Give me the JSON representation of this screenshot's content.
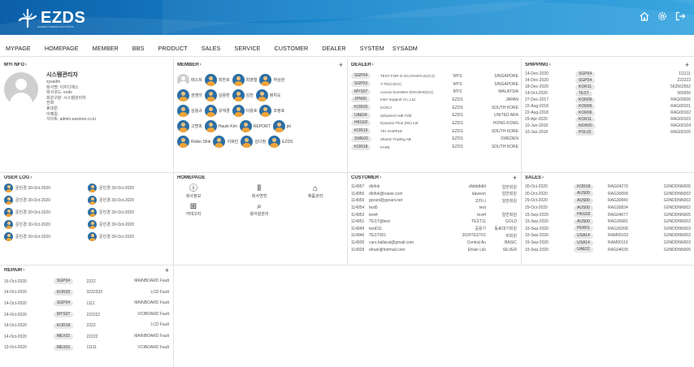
{
  "header": {
    "brand": "EZDS",
    "brand_sub": "ELEMENT DESIGN SOLUTIONS",
    "icons": [
      "home-icon",
      "gear-icon",
      "logout-icon"
    ]
  },
  "nav": [
    "MYPAGE",
    "HOMEPAGE",
    "MEMBER",
    "BBS",
    "PRODUCT",
    "SALES",
    "SERVICE",
    "CUSTOMER",
    "DEALER",
    "SYSTEM",
    "SYSADM"
  ],
  "myinfo": {
    "title": "MYI NFO",
    "name": "시스템관리자",
    "lines": [
      "sysadm",
      "회사명: 이지디에스",
      "회사코드: ezds",
      "회원구분: 시스템관리자",
      "전화:",
      "휴대폰:",
      "이메일:",
      "사이트: admin.easione.co.kr"
    ]
  },
  "member": {
    "title": "MEMBER",
    "rows": [
      [
        "테스트",
        "최한호",
        "최영철",
        "하상원"
      ],
      [
        "권영미",
        "김용환",
        "김찬",
        "배위도"
      ],
      [
        "심용규",
        "유재경",
        "이용호",
        "조정호"
      ],
      [
        "고명호",
        "Haule Kim",
        "REPORT",
        "pit"
      ],
      [
        "Robin Shin",
        "이화민",
        "김다정",
        "EZDS"
      ]
    ]
  },
  "dealer": {
    "title": "DEALER",
    "rows": [
      {
        "code": "SGP04",
        "name": "TEST FOR G-SCAN-MYL01(G1)",
        "group": "MYS",
        "country": "SINGAPORE"
      },
      {
        "code": "SGP03",
        "name": "Y-TECH(G1)",
        "group": "MYS",
        "country": "SINGAPORE"
      },
      {
        "code": "MYS07",
        "name": "Aurora SureWes SDN BHD(G1)",
        "group": "MYS",
        "country": "MALAYSIA"
      },
      {
        "code": "JPN00",
        "name": "Inter Support Co.,Ltd.",
        "group": "EZDS",
        "country": "JAPAN"
      },
      {
        "code": "KOR20",
        "name": "KOICA",
        "group": "EZDS",
        "country": "SOUTH KORE"
      },
      {
        "code": "UAE04",
        "name": "Zebartech ME FZE",
        "group": "EZDS",
        "country": "UNITED ARA"
      },
      {
        "code": "HKG02",
        "name": "Dynamic Plus (HK) Ltd",
        "group": "EZDS",
        "country": "HONG KONG"
      },
      {
        "code": "KOR19",
        "name": "TIH SAMPLE",
        "group": "EZDS",
        "country": "SOUTH KORE"
      },
      {
        "code": "SWE00",
        "name": "Skantz Trading AB",
        "group": "EZDS",
        "country": "SWEDEN"
      },
      {
        "code": "KOR18",
        "name": "FARK",
        "group": "EZDS",
        "country": "SOUTH KORE"
      }
    ]
  },
  "shipping": {
    "title": "SHIPPING",
    "rows": [
      {
        "date": "14-Dec-2020",
        "code": "SGP04",
        "no": "111111"
      },
      {
        "date": "14-Dec-2020",
        "code": "SGP04",
        "no": "222222"
      },
      {
        "date": "18-Dec-2020",
        "code": "KOR11",
        "no": "562562562"
      },
      {
        "date": "14-Oct-2020",
        "code": "TEST",
        "no": "565656"
      },
      {
        "date": "27-Dec-2017",
        "code": "KOR06",
        "no": "RAG00006"
      },
      {
        "date": "22-Aug-2018",
        "code": "KOR06",
        "no": "RAG00101"
      },
      {
        "date": "22-Aug-2018",
        "code": "KOR06",
        "no": "RAG00102"
      },
      {
        "date": "29-Apr-2020",
        "code": "KOR11",
        "no": "RAG00103"
      },
      {
        "date": "10-Jun-2018",
        "code": "NOR00",
        "no": "RAG00104"
      },
      {
        "date": "10-Jun-2018",
        "code": "POL02",
        "no": "RAG00105"
      }
    ]
  },
  "userlog": {
    "title": "USER LOG",
    "left": [
      "문민경 30-Oct-2020",
      "문민경 30-Oct-2020",
      "문민경 30-Oct-2020",
      "문민경 30-Oct-2020",
      "문민경 30-Oct-2020"
    ],
    "right": [
      "문민경 30-Oct-2020",
      "문민경 30-Oct-2020",
      "문민경 30-Oct-2020",
      "문민경 30-Oct-2020",
      "문민경 30-Oct-2020"
    ]
  },
  "homepage": {
    "title": "HOMEPAGE",
    "items": [
      {
        "label": "회사정보",
        "icon": "info-icon"
      },
      {
        "label": "회사연혁",
        "icon": "barcode-icon"
      },
      {
        "label": "제품관리",
        "icon": "products-icon"
      },
      {
        "label": "카테고리",
        "icon": "category-icon"
      },
      {
        "label": "용어설관리",
        "icon": "glossary-icon"
      }
    ]
  },
  "customer": {
    "title": "CUSTOMER",
    "rows": [
      {
        "id": "114957",
        "email": "dlofok",
        "name": "dldiddldld",
        "grade": "일반회원"
      },
      {
        "id": "114956",
        "email": "dlofok@naver.com",
        "name": "dawson",
        "grade": "일반회원"
      },
      {
        "id": "114955",
        "email": "gorani@gorani.net",
        "name": "고라니",
        "grade": "일반회원"
      },
      {
        "id": "114954",
        "email": "test5",
        "name": "test",
        "grade": ""
      },
      {
        "id": "114953",
        "email": "test4",
        "name": "test4",
        "grade": "일반회원"
      },
      {
        "id": "114951",
        "email": "TEST@test",
        "name": "TEST11",
        "grade": "GOLD"
      },
      {
        "id": "114949",
        "email": "test011",
        "name": "공용기",
        "grade": "동료대기회원"
      },
      {
        "id": "114946",
        "email": "TEST001",
        "name": "2020TEST01",
        "grade": "비회원"
      },
      {
        "id": "114930",
        "email": "cars.ballarat@gmail.com",
        "name": "Central Au",
        "grade": "BASIC"
      },
      {
        "id": "114929",
        "email": "efrain@hotmail.com",
        "name": "Efrain Lilo",
        "grade": "SILVER"
      }
    ]
  },
  "sales": {
    "title": "SALES",
    "rows": [
      {
        "date": "30-Oct-2020",
        "code": "KOR18",
        "rag": "RAG04279",
        "serial": "G0NDDNN005"
      },
      {
        "date": "30-Oct-2020",
        "code": "AUS00",
        "rag": "RAG30658",
        "serial": "G0NDDNN002"
      },
      {
        "date": "29-Oct-2020",
        "code": "AUS00",
        "rag": "RAG30840",
        "serial": "G0NDDNN002"
      },
      {
        "date": "29-Oct-2020",
        "code": "AUS00",
        "rag": "RAG30834",
        "serial": "G0NDDNN002"
      },
      {
        "date": "15-Sep-2020",
        "code": "HKG02",
        "rag": "RAG04677",
        "serial": "G0NDDNN005"
      },
      {
        "date": "15-Sep-2020",
        "code": "AUS00",
        "rag": "RAG30681",
        "serial": "G0NDDNN002"
      },
      {
        "date": "15-Sep-2020",
        "code": "PER01",
        "rag": "RAG30208",
        "serial": "G0NDDNN003"
      },
      {
        "date": "15-Sep-2020",
        "code": "USA14",
        "rag": "RAM00103",
        "serial": "G0NDDNN003"
      },
      {
        "date": "15-Sep-2020",
        "code": "USA14",
        "rag": "RAM00119",
        "serial": "G0NDDNN003"
      },
      {
        "date": "15-Sep-2020",
        "code": "UAE02",
        "rag": "RAG04039",
        "serial": "G0NDDNN005"
      }
    ]
  },
  "repair": {
    "title": "REPAIR",
    "rows": [
      {
        "date": "16-Oct-2020",
        "code": "SGP04",
        "no": "2222",
        "fault": "MAINBOARD Fault"
      },
      {
        "date": "14-Oct-2020",
        "code": "KOR20",
        "no": "3232333",
        "fault": "LCD Fault"
      },
      {
        "date": "14-Oct-2020",
        "code": "SGP04",
        "no": "1111",
        "fault": "MAINBOARD Fault"
      },
      {
        "date": "14-Oct-2020",
        "code": "MYS07",
        "no": "222222",
        "fault": "VCIBOARD Fault"
      },
      {
        "date": "14-Oct-2020",
        "code": "KOR18",
        "no": "2222",
        "fault": "LCD Fault"
      },
      {
        "date": "14-Oct-2020",
        "code": "MEX01",
        "no": "22222",
        "fault": "MAINBOARD Fault"
      },
      {
        "date": "13-Oct-2020",
        "code": "MEX01",
        "no": "11111",
        "fault": "VCIBOARD Fault"
      }
    ]
  }
}
